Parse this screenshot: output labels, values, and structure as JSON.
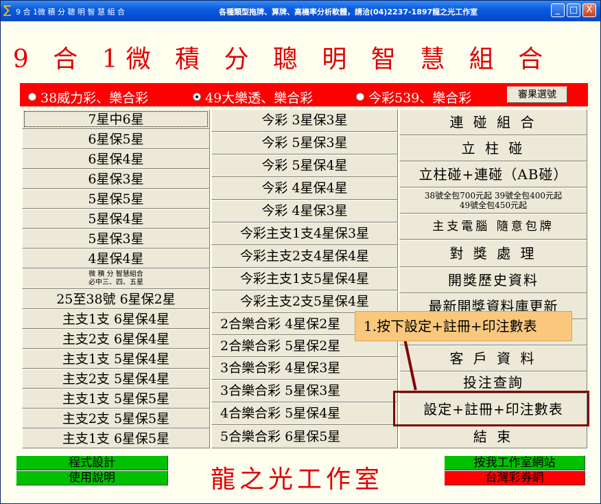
{
  "window": {
    "icon": "sigma-icon",
    "title": "9 合 1微 積 分 聰 明 智 慧 組 合",
    "subtitle": "各種類型拖牌、算牌、高機率分析軟體，請洽(04)2237-1897龍之光工作室",
    "min_glyph": "_",
    "max_glyph": "□",
    "close_glyph": "X"
  },
  "app_title": "9 合 1微 積 分 聰 明 智 慧 組 合",
  "modes": [
    {
      "label": "38威力彩、樂合彩",
      "selected": false
    },
    {
      "label": "49大樂透、樂合彩",
      "selected": true
    },
    {
      "label": "今彩539、樂合彩",
      "selected": false
    }
  ],
  "confirm_label": "審果選號",
  "col_a": [
    "7星中6星",
    "6星保5星",
    "6星保4星",
    "6星保3星",
    "5星保5星",
    "5星保4星",
    "5星保3星",
    "4星保4星",
    "微 積 分 智慧組合",
    "必中三、四、五星",
    "25至38號 6星保2星",
    "主支1支  6星保4星",
    "主支2支  6星保4星",
    "主支1支  5星保4星",
    "主支2支  5星保4星",
    "主支1支  5星保5星",
    "主支2支  5星保5星",
    "主支1支  6星保5星"
  ],
  "col_b": [
    "今彩 3星保3星",
    "今彩 5星保3星",
    "今彩 5星保4星",
    "今彩 4星保4星",
    "今彩 4星保3星",
    "今彩主支1支4星保3星",
    "今彩主支2支4星保4星",
    "今彩主支1支5星保4星",
    "今彩主支2支5星保4星",
    "2合樂合彩  4星保2星",
    "2合樂合彩  5星保2星",
    "3合樂合彩  4星保3星",
    "3合樂合彩  5星保3星",
    "4合樂合彩  5星保4星",
    "5合樂合彩  6星保5星"
  ],
  "col_c": [
    "連 碰 組 合",
    "立 柱 碰",
    "立柱碰+連碰（AB碰）",
    "38號全包700元起 39號全包400元起",
    "49號全包450元起",
    "主支電腦 隨意包牌",
    "對 獎 處 理",
    "開獎歷史資料",
    "最新開獎資料庫更新",
    "",
    "客 戶 資 料",
    "投注查詢",
    "設定+註冊+印注數表",
    "結 束"
  ],
  "callout_text": "1.按下設定+註冊+印注數表",
  "footer": {
    "left_1": "程式設計",
    "left_2": "使用說明",
    "brand": "龍之光工作室",
    "right_1": "按我工作室網站",
    "right_2": "台灣彩券網"
  },
  "colors": {
    "accent": "#ff0000",
    "title_red": "#e00000",
    "green": "#00c000",
    "callout": "#f9c87d",
    "callout_border": "#800000"
  }
}
